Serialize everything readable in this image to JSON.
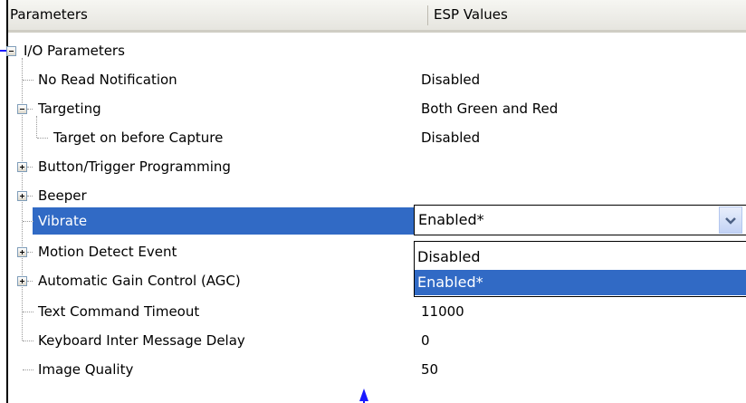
{
  "header": {
    "parameters_label": "Parameters",
    "values_label": "ESP Values"
  },
  "tree": {
    "rows": [
      {
        "label": "I/O Parameters",
        "value": "",
        "expander": "minus"
      },
      {
        "label": "No Read Notification",
        "value": "Disabled",
        "expander": "none"
      },
      {
        "label": "Targeting",
        "value": "Both Green and Red",
        "expander": "minus"
      },
      {
        "label": "Target on before Capture",
        "value": "Disabled",
        "expander": "none"
      },
      {
        "label": "Button/Trigger Programming",
        "value": "",
        "expander": "plus"
      },
      {
        "label": "Beeper",
        "value": "",
        "expander": "plus"
      },
      {
        "label": "Vibrate",
        "value": "",
        "expander": "none",
        "selected": true
      },
      {
        "label": "Motion Detect Event",
        "value": "",
        "expander": "plus"
      },
      {
        "label": "Automatic Gain Control (AGC)",
        "value": "",
        "expander": "plus"
      },
      {
        "label": "Text Command Timeout",
        "value": "11000",
        "expander": "none"
      },
      {
        "label": "Keyboard Inter Message Delay",
        "value": "0",
        "expander": "none"
      },
      {
        "label": "Image Quality",
        "value": "50",
        "expander": "none"
      }
    ]
  },
  "vibrate_combo": {
    "selected": "Enabled*",
    "options": [
      "Disabled",
      "Enabled*"
    ],
    "highlighted_option": "Enabled*"
  },
  "colors": {
    "selection": "#316ac5",
    "callout_arrow": "#1a1aff",
    "header_bg": "#ece9d8"
  },
  "icons": {
    "expand": "plus-box-icon",
    "collapse": "minus-box-icon",
    "dropdown": "chevron-down-icon",
    "callout": "arrow-icon"
  }
}
